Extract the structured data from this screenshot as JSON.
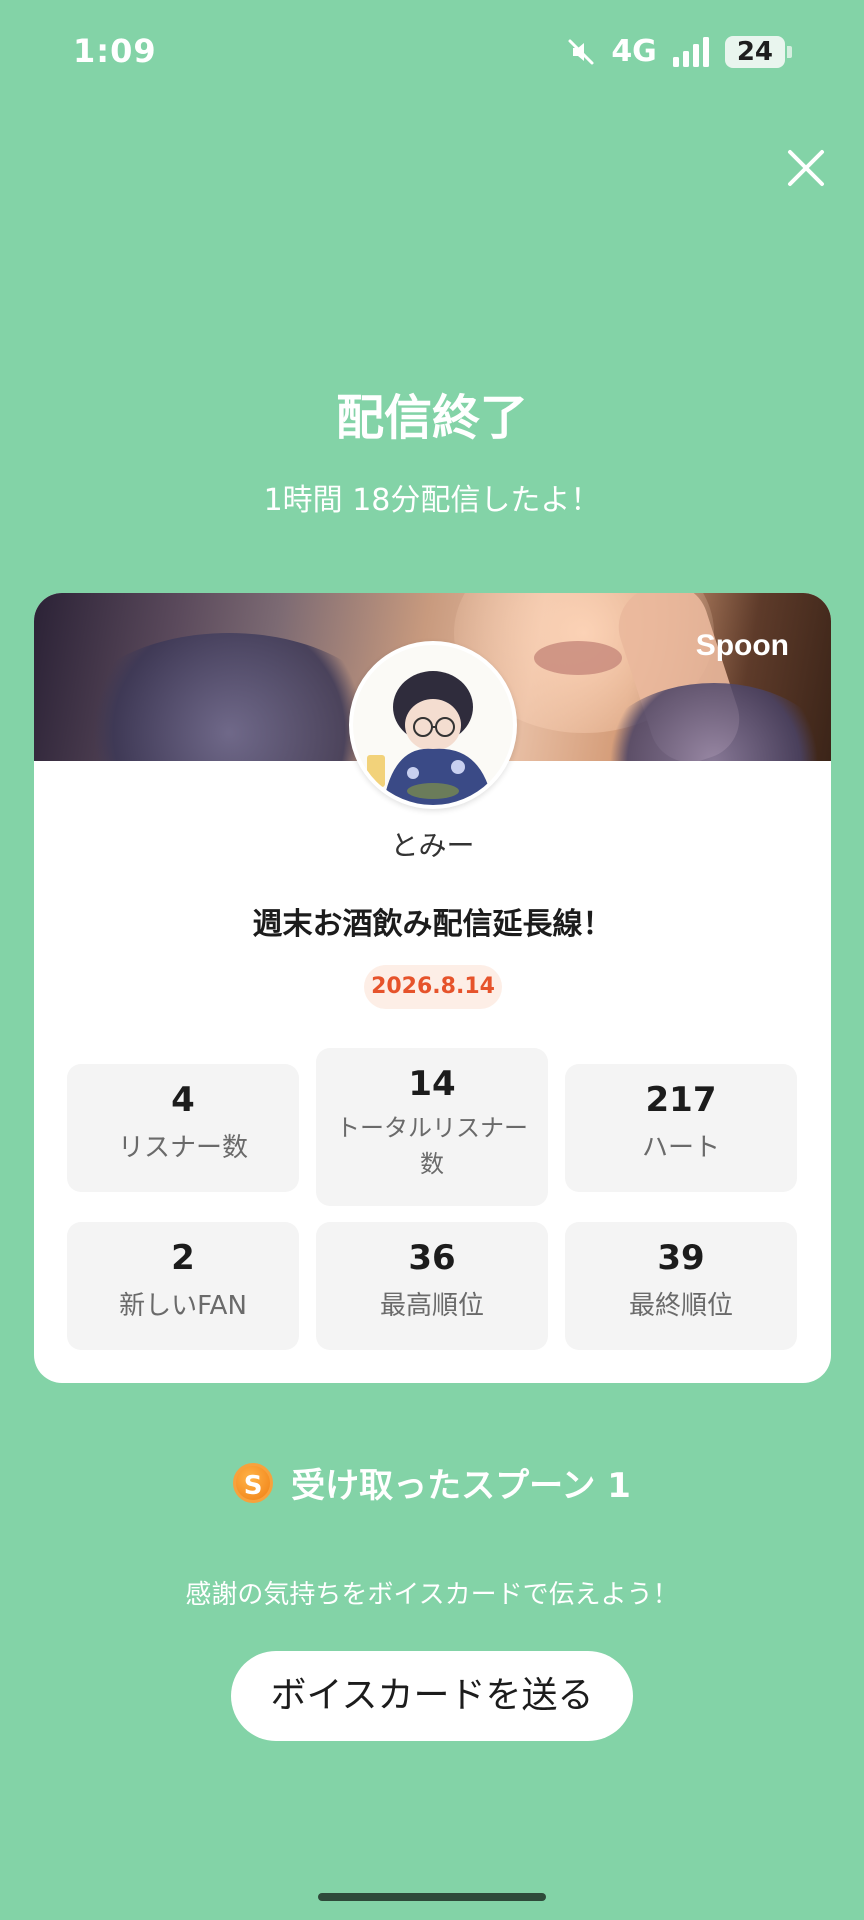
{
  "status_bar": {
    "time": "1:09",
    "network": "4G",
    "battery": "24",
    "icons": [
      "mute-icon",
      "signal-icon",
      "battery-icon"
    ]
  },
  "header": {
    "title": "配信終了",
    "duration": "1時間 18分配信したよ！"
  },
  "card": {
    "brand": "Spoon",
    "host_name": "とみー",
    "stream_title": "週末お酒飲み配信延長線！",
    "date": "2026.8.14",
    "stats": [
      {
        "value": "4",
        "label": "リスナー数"
      },
      {
        "value": "14",
        "label": "トータルリスナー数"
      },
      {
        "value": "217",
        "label": "ハート"
      },
      {
        "value": "2",
        "label": "新しいFAN"
      },
      {
        "value": "36",
        "label": "最高順位"
      },
      {
        "value": "39",
        "label": "最終順位"
      }
    ]
  },
  "spoon": {
    "coin_letter": "S",
    "label": "受け取ったスプーン 1"
  },
  "footer": {
    "thanks": "感謝の気持ちをボイスカードで伝えよう！",
    "button_label": "ボイスカードを送る"
  },
  "colors": {
    "background": "#83d3a7",
    "date_badge_text": "#e6532b",
    "date_badge_bg": "#fdeee6"
  }
}
